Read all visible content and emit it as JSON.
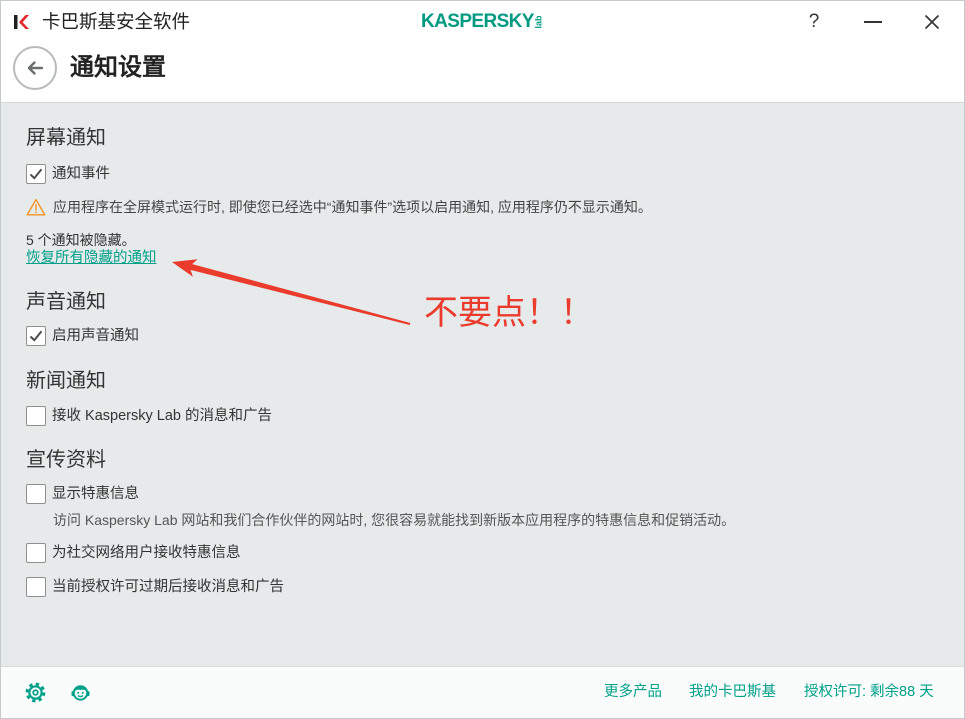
{
  "window": {
    "title": "卡巴斯基安全软件",
    "app_icon": "kaspersky-k-icon",
    "logo_text": "KASPERSKY",
    "logo_sub": "lab",
    "help": "?",
    "minimize_icon": "minimize-icon",
    "close_icon": "close-icon"
  },
  "header": {
    "back_icon": "arrow-left-icon",
    "title": "通知设置"
  },
  "screen_notifications": {
    "heading": "屏幕通知",
    "notify_events": {
      "label": "通知事件",
      "checked": true
    },
    "warning_icon": "warning-icon",
    "warning": "应用程序在全屏模式运行时, 即使您已经选中“通知事件”选项以启用通知, 应用程序仍不显示通知。",
    "hidden_count": "5 个通知被隐藏。",
    "restore_link": "恢复所有隐藏的通知"
  },
  "sound_notifications": {
    "heading": "声音通知",
    "enable_sound": {
      "label": "启用声音通知",
      "checked": true
    }
  },
  "news_notifications": {
    "heading": "新闻通知",
    "receive_news": {
      "label": "接收 Kaspersky Lab 的消息和广告",
      "checked": false
    }
  },
  "promo_materials": {
    "heading": "宣传资料",
    "show_offers": {
      "label": "显示特惠信息",
      "checked": false,
      "description": "访问 Kaspersky Lab 网站和我们合作伙伴的网站时, 您很容易就能找到新版本应用程序的特惠信息和促销活动。"
    },
    "social_offers": {
      "label": "为社交网络用户接收特惠信息",
      "checked": false
    },
    "after_expiry": {
      "label": "当前授权许可过期后接收消息和广告",
      "checked": false
    }
  },
  "footer": {
    "settings_icon": "gear-icon",
    "support_icon": "support-icon",
    "more_products": "更多产品",
    "my_kaspersky": "我的卡巴斯基",
    "license": "授权许可: 剩余88 天"
  },
  "annotation": {
    "text": "不要点！！",
    "arrow_icon": "red-arrow"
  },
  "colors": {
    "accent": "#00a08a",
    "logo": "#009a82",
    "panel": "#e6eaeb",
    "annotation": "#ea3b2c",
    "warning": "#f39321"
  }
}
